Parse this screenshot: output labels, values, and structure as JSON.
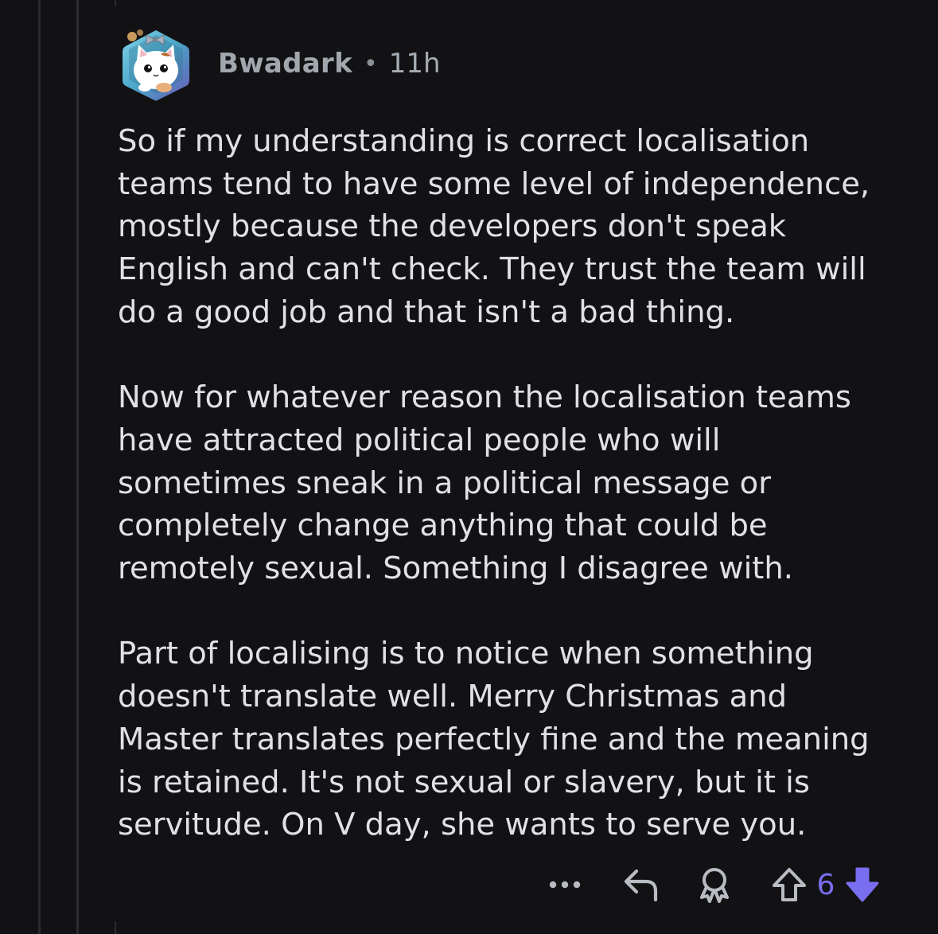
{
  "comment": {
    "author": "Bwadark",
    "separator": "•",
    "time": "11h",
    "paragraphs": [
      [
        "So if my understanding is correct localisation",
        "teams tend to have some level of independence,",
        "mostly because the developers don't speak",
        "English and can't check. They trust the team will",
        "do a good job and that isn't a bad thing."
      ],
      [
        "Now for whatever reason the localisation teams",
        "have attracted political people who will",
        "sometimes sneak in a political message or",
        "completely change anything that could be",
        "remotely sexual. Something I disagree with."
      ],
      [
        "Part of localising is to notice when something",
        "doesn't translate well. Merry Christmas and",
        "Master translates perfectly fine and the meaning",
        "is retained. It's not sexual or slavery, but it is",
        "servitude. On V day, she wants to serve you."
      ]
    ]
  },
  "actions": {
    "more_icon": "more-dots-icon",
    "reply_icon": "reply-arrow-icon",
    "award_icon": "award-icon",
    "upvote_icon": "upvote-outline-icon",
    "score": "6",
    "downvote_icon": "downvote-filled-icon"
  },
  "colors": {
    "background": "#121215",
    "text": "#dfe1e5",
    "meta": "#a7acb3",
    "vote_active": "#7a6ef0",
    "icon": "#b8bcc2"
  }
}
